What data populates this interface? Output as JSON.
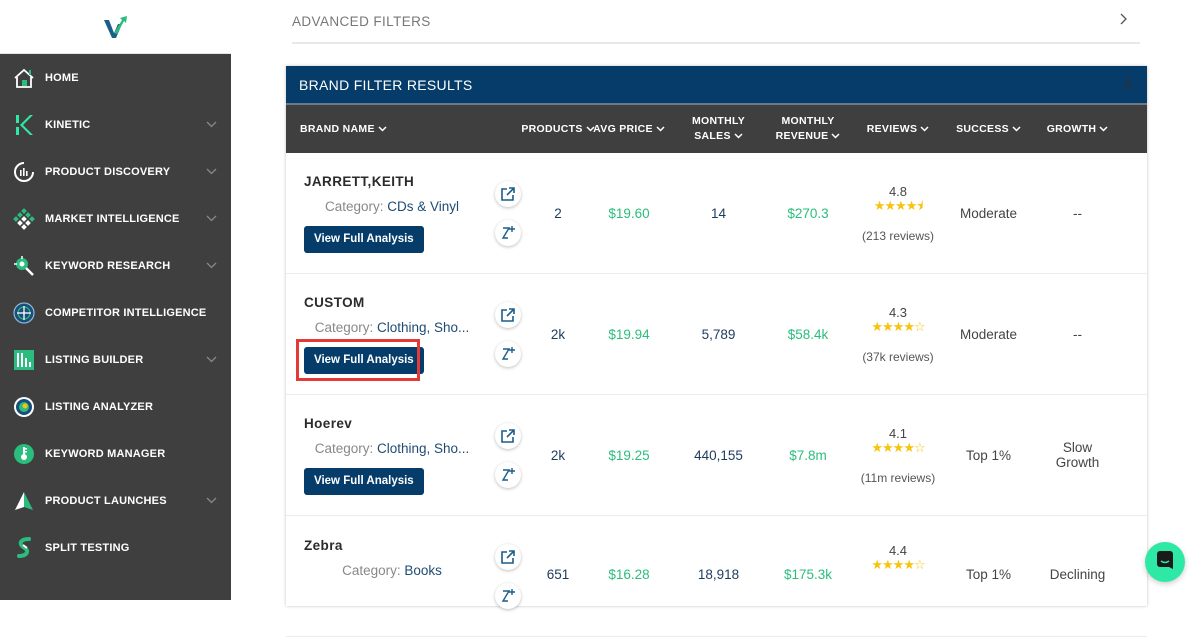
{
  "sidebar": {
    "logo": "v-logo",
    "items": [
      {
        "label": "HOME",
        "icon": "home-icon",
        "has_chevron": false
      },
      {
        "label": "KINETIC",
        "icon": "kinetic-k-icon",
        "has_chevron": true
      },
      {
        "label": "PRODUCT DISCOVERY",
        "icon": "product-discovery-icon",
        "has_chevron": true
      },
      {
        "label": "MARKET INTELLIGENCE",
        "icon": "market-intelligence-icon",
        "has_chevron": true
      },
      {
        "label": "KEYWORD RESEARCH",
        "icon": "keyword-research-icon",
        "has_chevron": true
      },
      {
        "label": "COMPETITOR INTELLIGENCE",
        "icon": "competitor-intelligence-icon",
        "has_chevron": false
      },
      {
        "label": "LISTING BUILDER",
        "icon": "listing-builder-icon",
        "has_chevron": true
      },
      {
        "label": "LISTING ANALYZER",
        "icon": "listing-analyzer-icon",
        "has_chevron": false
      },
      {
        "label": "KEYWORD MANAGER",
        "icon": "keyword-manager-icon",
        "has_chevron": false
      },
      {
        "label": "PRODUCT LAUNCHES",
        "icon": "product-launches-icon",
        "has_chevron": true
      },
      {
        "label": "SPLIT TESTING",
        "icon": "split-testing-icon",
        "has_chevron": false
      }
    ]
  },
  "advanced_filters": {
    "label": "ADVANCED FILTERS"
  },
  "results": {
    "title": "BRAND FILTER RESULTS",
    "columns": {
      "brand_name": "BRAND NAME",
      "products": "PRODUCTS",
      "avg_price": "AVG PRICE",
      "monthly_sales_1": "MONTHLY",
      "monthly_sales_2": "SALES",
      "monthly_revenue_1": "MONTHLY",
      "monthly_revenue_2": "REVENUE",
      "reviews": "REVIEWS",
      "success": "SUCCESS",
      "growth": "GROWTH"
    },
    "category_prefix": "Category: ",
    "view_button_label": "View Full Analysis",
    "rows": [
      {
        "brand": "JARRETT,KEITH",
        "category": "CDs & Vinyl",
        "products": "2",
        "avg_price": "$19.60",
        "monthly_sales": "14",
        "monthly_revenue": "$270.3",
        "rating": "4.8",
        "stars": "★★★★⯨",
        "review_count": "(213 reviews)",
        "success": "Moderate",
        "growth": "--"
      },
      {
        "brand": "CUSTOM",
        "category": "Clothing, Sho...",
        "products": "2k",
        "avg_price": "$19.94",
        "monthly_sales": "5,789",
        "monthly_revenue": "$58.4k",
        "rating": "4.3",
        "stars": "★★★★☆",
        "review_count": "(37k reviews)",
        "success": "Moderate",
        "growth": "--",
        "highlighted": true
      },
      {
        "brand": "Hoerev",
        "category": "Clothing, Sho...",
        "products": "2k",
        "avg_price": "$19.25",
        "monthly_sales": "440,155",
        "monthly_revenue": "$7.8m",
        "rating": "4.1",
        "stars": "★★★★☆",
        "review_count": "(11m reviews)",
        "success": "Top 1%",
        "growth_1": "Slow",
        "growth_2": "Growth"
      },
      {
        "brand": "Zebra",
        "category": "Books",
        "products": "651",
        "avg_price": "$16.28",
        "monthly_sales": "18,918",
        "monthly_revenue": "$175.3k",
        "rating": "4.4",
        "stars": "★★★★☆",
        "review_count": "",
        "success": "Top 1%",
        "growth": "Declining"
      }
    ]
  },
  "colors": {
    "brand_blue": "#053c69",
    "sidebar_bg": "#3f3f3f",
    "green": "#2bbd7e",
    "accent_mint": "#2ee8a5",
    "highlight_red": "#e53935",
    "star_yellow": "#f6c40c"
  }
}
